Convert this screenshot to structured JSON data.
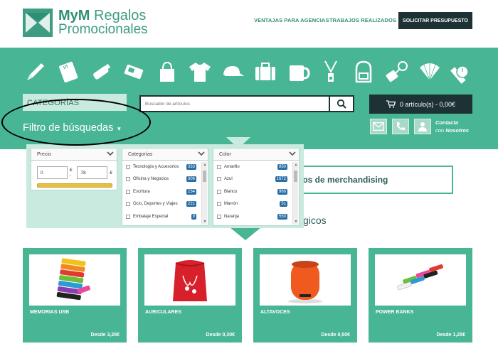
{
  "brand": {
    "name_bold": "MyM",
    "name_rest": "Regalos",
    "name_line2": "Promocionales"
  },
  "nav": {
    "agencias": "VENTAJAS PARA AGENCIAS",
    "trabajos": "TRABAJOS REALIZADOS",
    "presupuesto": "SOLICITAR PRESUPUESTO"
  },
  "categories_icons": [
    "pen-icon",
    "notebook-icon",
    "usb-icon",
    "powerbank-icon",
    "bag-icon",
    "tshirt-icon",
    "cap-icon",
    "suitcase-icon",
    "mug-icon",
    "lanyard-icon",
    "backpack-icon",
    "keychain-icon",
    "fan-icon",
    "watch-icon"
  ],
  "category_tab": "CATEGORÍAS",
  "search": {
    "placeholder": "Buscador de artículos"
  },
  "cart": {
    "label": "0 artículo(s) - 0,00€"
  },
  "filter": {
    "title": "Filtro de búsquedas",
    "price": {
      "header": "Precio",
      "min": "0",
      "max": "78",
      "currency": "€",
      "sep": "€ -"
    },
    "categorias": {
      "header": "Categorías",
      "items": [
        {
          "label": "Tecnología y Accesorios",
          "count": "333"
        },
        {
          "label": "Oficina y Negocios",
          "count": "306"
        },
        {
          "label": "Escritura",
          "count": "234"
        },
        {
          "label": "Ocio, Deportes y Viajes",
          "count": "221"
        },
        {
          "label": "Embalaje Especial",
          "count": "9"
        }
      ]
    },
    "color": {
      "header": "Color",
      "items": [
        {
          "label": "Amarillo",
          "count": "850"
        },
        {
          "label": "Azul",
          "count": "1672"
        },
        {
          "label": "Blanco",
          "count": "966"
        },
        {
          "label": "Marrón",
          "count": "51"
        },
        {
          "label": "Naranja",
          "count": "550"
        }
      ]
    }
  },
  "contact": {
    "line1": "Contacta",
    "line2_pre": "con",
    "line2_bold": "Nosotros"
  },
  "merch_text": "los de merchandising",
  "sub_text": "gicos",
  "products": [
    {
      "name": "MEMORIAS USB",
      "price": "Desde 3,35€"
    },
    {
      "name": "AURICULARES",
      "price": "Desde 0,30€"
    },
    {
      "name": "ALTAVOCES",
      "price": "Desde 0,50€"
    },
    {
      "name": "POWER BANKS",
      "price": "Desde 1,25€"
    }
  ],
  "colors": {
    "teal": "#48b595",
    "dark": "#1d3234",
    "light": "#c8eadf",
    "badge": "#2a6ea6"
  }
}
